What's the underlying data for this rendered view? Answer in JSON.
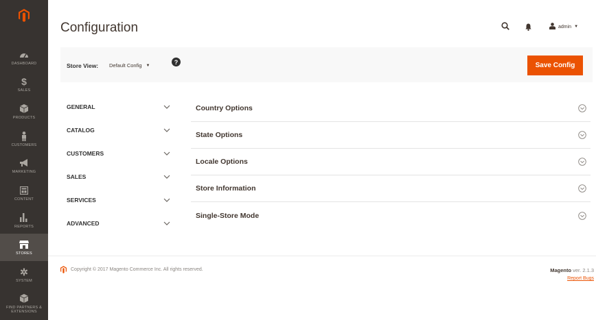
{
  "sidebar": {
    "logo": "magento-logo",
    "items": [
      {
        "label": "DASHBOARD",
        "icon": "dashboard-icon",
        "active": false
      },
      {
        "label": "SALES",
        "icon": "dollar-icon",
        "active": false
      },
      {
        "label": "PRODUCTS",
        "icon": "cube-icon",
        "active": false
      },
      {
        "label": "CUSTOMERS",
        "icon": "person-icon",
        "active": false
      },
      {
        "label": "MARKETING",
        "icon": "megaphone-icon",
        "active": false
      },
      {
        "label": "CONTENT",
        "icon": "layout-icon",
        "active": false
      },
      {
        "label": "REPORTS",
        "icon": "bar-chart-icon",
        "active": false
      },
      {
        "label": "STORES",
        "icon": "store-icon",
        "active": true
      },
      {
        "label": "SYSTEM",
        "icon": "gear-icon",
        "active": false
      },
      {
        "label": "FIND PARTNERS & EXTENSIONS",
        "icon": "cube-icon",
        "active": false
      }
    ]
  },
  "header": {
    "title": "Configuration",
    "user": "admin"
  },
  "store_bar": {
    "label": "Store View:",
    "value": "Default Config",
    "save_label": "Save Config"
  },
  "tabs": [
    {
      "label": "GENERAL"
    },
    {
      "label": "CATALOG"
    },
    {
      "label": "CUSTOMERS"
    },
    {
      "label": "SALES"
    },
    {
      "label": "SERVICES"
    },
    {
      "label": "ADVANCED"
    }
  ],
  "sections": [
    {
      "label": "Country Options"
    },
    {
      "label": "State Options"
    },
    {
      "label": "Locale Options"
    },
    {
      "label": "Store Information"
    },
    {
      "label": "Single-Store Mode"
    }
  ],
  "footer": {
    "copyright": "Copyright © 2017 Magento Commerce Inc. All rights reserved.",
    "brand": "Magento",
    "version": "ver. 2.1.3",
    "report": "Report Bugs"
  },
  "colors": {
    "accent": "#eb5202",
    "sidebar": "#373330"
  }
}
